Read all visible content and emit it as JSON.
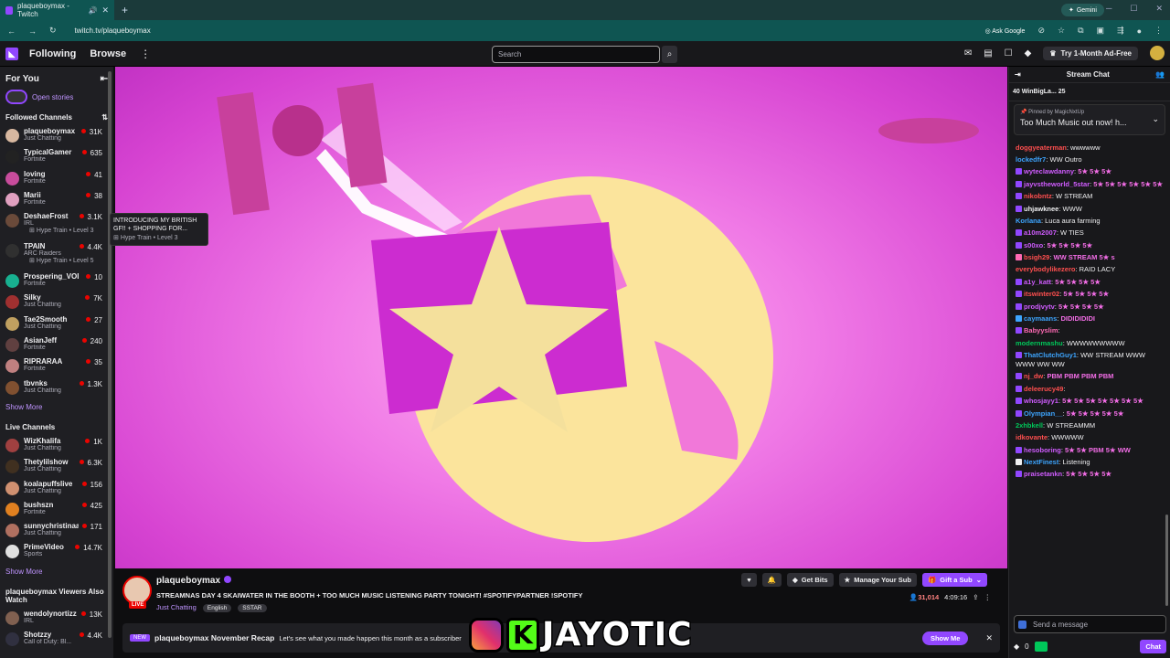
{
  "browser": {
    "tab_title": "plaqueboymax - Twitch",
    "url": "twitch.tv/plaqueboymax",
    "gemini": "Gemini",
    "ask_google": "Ask Google"
  },
  "topnav": {
    "following": "Following",
    "browse": "Browse",
    "search_placeholder": "Search",
    "ad_free": "Try 1-Month Ad-Free"
  },
  "sidebar": {
    "for_you": "For You",
    "open_stories": "Open stories",
    "followed_header": "Followed Channels",
    "followed": [
      {
        "name": "plaqueboymax",
        "cat": "Just Chatting",
        "viewers": "31K",
        "color": "#d8b8a0"
      },
      {
        "name": "TypicalGamer",
        "cat": "Fortnite",
        "viewers": "635",
        "color": "#222222"
      },
      {
        "name": "loving",
        "cat": "Fortnite",
        "viewers": "41",
        "color": "#c84c9c"
      },
      {
        "name": "Marii",
        "cat": "Fortnite",
        "viewers": "38",
        "color": "#e0a0c0"
      }
    ],
    "deshae": {
      "name": "DeshaeFrost",
      "cat": "IRL",
      "viewers": "3.1K",
      "hype": "Hype Train • Level 3",
      "color": "#6a4a3a"
    },
    "tpain": {
      "name": "TPAIN",
      "cat": "ARC Raiders",
      "viewers": "4.4K",
      "hype": "Hype Train • Level 5",
      "color": "#303030"
    },
    "followed2": [
      {
        "name": "Prospering_VODs",
        "cat": "Fortnite",
        "viewers": "10",
        "color": "#18b090"
      },
      {
        "name": "Silky",
        "cat": "Just Chatting",
        "viewers": "7K",
        "color": "#a03030"
      },
      {
        "name": "Tae2Smooth",
        "cat": "Just Chatting",
        "viewers": "27",
        "color": "#c0a060"
      },
      {
        "name": "AsianJeff",
        "cat": "Fortnite",
        "viewers": "240",
        "color": "#604040"
      },
      {
        "name": "RIPRARAA",
        "cat": "Fortnite",
        "viewers": "35",
        "color": "#c08080"
      },
      {
        "name": "tbvnks",
        "cat": "Just Chatting",
        "viewers": "1.3K",
        "color": "#805030"
      }
    ],
    "show_more": "Show More",
    "live_header": "Live Channels",
    "live": [
      {
        "name": "WizKhalifa",
        "cat": "Just Chatting",
        "viewers": "1K",
        "color": "#a04040"
      },
      {
        "name": "Thetylilshow",
        "cat": "Just Chatting",
        "viewers": "6.3K",
        "color": "#403020"
      },
      {
        "name": "koalapuffslive",
        "cat": "Just Chatting",
        "viewers": "156",
        "color": "#d09070"
      },
      {
        "name": "bushszn",
        "cat": "Fortnite",
        "viewers": "425",
        "color": "#e08020"
      },
      {
        "name": "sunnychristinaa",
        "cat": "Just Chatting",
        "viewers": "171",
        "color": "#b07060"
      },
      {
        "name": "PrimeVideo",
        "cat": "Sports",
        "viewers": "14.7K",
        "color": "#e0e0e0"
      }
    ],
    "show_more2": "Show More",
    "also_watch_header": "plaqueboymax Viewers Also Watch",
    "also": [
      {
        "name": "wendolynortizz",
        "cat": "IRL",
        "viewers": "13K",
        "color": "#806050"
      },
      {
        "name": "Shotzzy",
        "cat": "Call of Duty: Bl...",
        "viewers": "4.4K",
        "color": "#303040"
      }
    ],
    "tooltip_title": "INTRODUCING MY BRITISH GF!! + SHOPPING FOR...",
    "tooltip_sub": "Hype Train • Level 3"
  },
  "stream": {
    "name": "plaqueboymax",
    "live": "LIVE",
    "title": "STREAMNAS DAY 4 SKAIWATER IN THE BOOTH + TOO MUCH MUSIC LISTENING PARTY TONIGHT! #SPOTIFYPARTNER !SPOTIFY",
    "category": "Just Chatting",
    "tags": [
      "English",
      "SSTAR"
    ],
    "get_bits": "Get Bits",
    "manage_sub": "Manage Your Sub",
    "gift_sub": "Gift a Sub",
    "viewers": "31,014",
    "uptime": "4:09:16"
  },
  "recap": {
    "badge": "NEW",
    "title": "plaqueboymax November Recap",
    "desc": "Let's see what you made happen this month as a subscriber",
    "button": "Show Me"
  },
  "watermark": {
    "k": "K",
    "text": "JAYOTIC"
  },
  "chat": {
    "header": "Stream Chat",
    "leaderboard": "40 WinBigLa... 25",
    "pinned_by": "Pinned by MagicNxtUp",
    "pinned_text": "Too Much Music out now! h...",
    "messages": [
      {
        "user": "doggyeaterman",
        "color": "#ff4f4f",
        "text": "wwwwww",
        "badge": ""
      },
      {
        "user": "lockedfr7",
        "color": "#3da5ff",
        "text": "WW Outro",
        "badge": ""
      },
      {
        "user": "wyteclawdanny",
        "color": "#d05cff",
        "text": "5★ 5★ 5★",
        "badge": "#9147ff"
      },
      {
        "user": "jayvstheworld_5star",
        "color": "#d05cff",
        "text": "5★ 5★ 5★ 5★ 5★ 5★",
        "badge": "#9147ff"
      },
      {
        "user": "nikobntz",
        "color": "#ff4f4f",
        "text": "W STREAM",
        "badge": "#9147ff"
      },
      {
        "user": "uhjawknee",
        "color": "#efeff1",
        "text": "WWW",
        "badge": "#9147ff"
      },
      {
        "user": "Korlana",
        "color": "#3da5ff",
        "text": "Luca aura farming",
        "badge": ""
      },
      {
        "user": "a10m2007",
        "color": "#d05cff",
        "text": "W TIES",
        "badge": "#9147ff"
      },
      {
        "user": "s00xo",
        "color": "#d05cff",
        "text": "5★ 5★ 5★ 5★",
        "badge": "#9147ff"
      },
      {
        "user": "bsigh29",
        "color": "#ff4f4f",
        "text": "WW STREAM 5★ s",
        "badge": "#ff69b4"
      },
      {
        "user": "everybodylikezero",
        "color": "#ff4f4f",
        "text": "RAID LACY",
        "badge": ""
      },
      {
        "user": "a1y_katt",
        "color": "#d05cff",
        "text": "5★ 5★ 5★ 5★",
        "badge": "#9147ff"
      },
      {
        "user": "itswinter02",
        "color": "#ff4f4f",
        "text": "5★ 5★ 5★ 5★",
        "badge": "#9147ff"
      },
      {
        "user": "prodjvytv",
        "color": "#d05cff",
        "text": "5★ 5★ 5★ 5★",
        "badge": "#9147ff"
      },
      {
        "user": "caymaans",
        "color": "#3da5ff",
        "text": "DIDIDIDIDI",
        "badge": "#3da5ff"
      },
      {
        "user": "Babyyslim",
        "color": "#ff69b4",
        "text": "",
        "badge": "#9147ff"
      },
      {
        "user": "modernmashu",
        "color": "#00c85a",
        "text": "WWWWWWWWW",
        "badge": ""
      },
      {
        "user": "ThatClutchGuy1",
        "color": "#3da5ff",
        "text": "WW STREAM WWW WWW WW WW",
        "badge": "#9147ff"
      },
      {
        "user": "nj_dw",
        "color": "#ff4f4f",
        "text": "PBM PBM PBM PBM",
        "badge": "#9147ff"
      },
      {
        "user": "deleerucy49",
        "color": "#ff4f4f",
        "text": "",
        "badge": "#9147ff"
      },
      {
        "user": "whosjayy1",
        "color": "#d05cff",
        "text": "5★ 5★ 5★ 5★ 5★ 5★ 5★",
        "badge": "#9147ff"
      },
      {
        "user": "Olympian__",
        "color": "#3da5ff",
        "text": "5★ 5★ 5★ 5★ 5★",
        "badge": "#9147ff"
      },
      {
        "user": "2xhbkell",
        "color": "#00c85a",
        "text": "W STREAMMM",
        "badge": ""
      },
      {
        "user": "idkovante",
        "color": "#ff4f4f",
        "text": "WWWWW",
        "badge": ""
      },
      {
        "user": "hesoboring",
        "color": "#d05cff",
        "text": "5★ 5★ PBM 5★ WW",
        "badge": "#9147ff"
      },
      {
        "user": "NextFinest",
        "color": "#3da5ff",
        "text": "Listening",
        "badge": "#efeff1"
      },
      {
        "user": "praisetankn",
        "color": "#d05cff",
        "text": "5★ 5★ 5★ 5★",
        "badge": "#9147ff"
      }
    ],
    "input_placeholder": "Send a message",
    "points": "0",
    "chat_button": "Chat"
  }
}
